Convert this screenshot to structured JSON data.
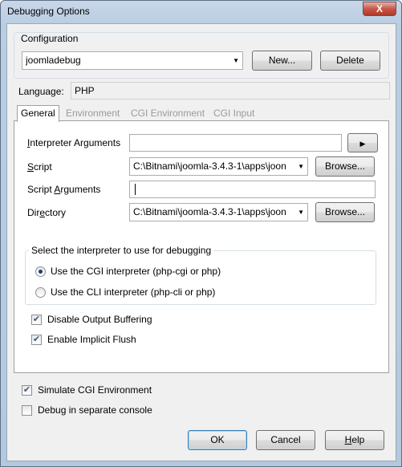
{
  "window": {
    "title": "Debugging Options",
    "close_symbol": "X"
  },
  "configuration": {
    "legend": "Configuration",
    "selected": "joomladebug",
    "new_button": "New...",
    "delete_button": "Delete"
  },
  "language": {
    "label": "Language:",
    "value": "PHP"
  },
  "tabs": [
    {
      "label": "General",
      "active": true
    },
    {
      "label": "Environment",
      "active": false
    },
    {
      "label": "CGI Environment",
      "active": false
    },
    {
      "label": "CGI Input",
      "active": false
    }
  ],
  "general": {
    "interpreter_args": {
      "label_pre": "I",
      "label_post": "nterpreter Arguments",
      "value": ""
    },
    "script": {
      "label_pre": "S",
      "label_post": "cript",
      "value": "C:\\Bitnami\\joomla-3.4.3-1\\apps\\joon",
      "browse": "Browse..."
    },
    "script_args": {
      "label_pre": "Script ",
      "label_ul": "A",
      "label_post": "rguments",
      "value": ""
    },
    "directory": {
      "label_pre": "Dir",
      "label_ul": "e",
      "label_post": "ctory",
      "value": "C:\\Bitnami\\joomla-3.4.3-1\\apps\\joon",
      "browse": "Browse..."
    },
    "interpreter_group": {
      "legend": "Select the interpreter to use for debugging",
      "cgi_label": "Use the CGI interpreter (php-cgi or php)",
      "cli_label": "Use the CLI interpreter (php-cli or php)",
      "selected": "cgi"
    },
    "disable_output_buffering": {
      "label": "Disable Output Buffering",
      "checked": true
    },
    "enable_implicit_flush": {
      "label": "Enable Implicit Flush",
      "checked": true
    }
  },
  "simulate_cgi": {
    "label": "Simulate CGI Environment",
    "checked": true
  },
  "separate_console": {
    "label": "Debug in separate console",
    "checked": false
  },
  "footer": {
    "ok": "OK",
    "cancel": "Cancel",
    "help_ul": "H",
    "help_post": "elp"
  },
  "glyphs": {
    "check": "✔",
    "play": "▶",
    "dropdown": "▼"
  }
}
